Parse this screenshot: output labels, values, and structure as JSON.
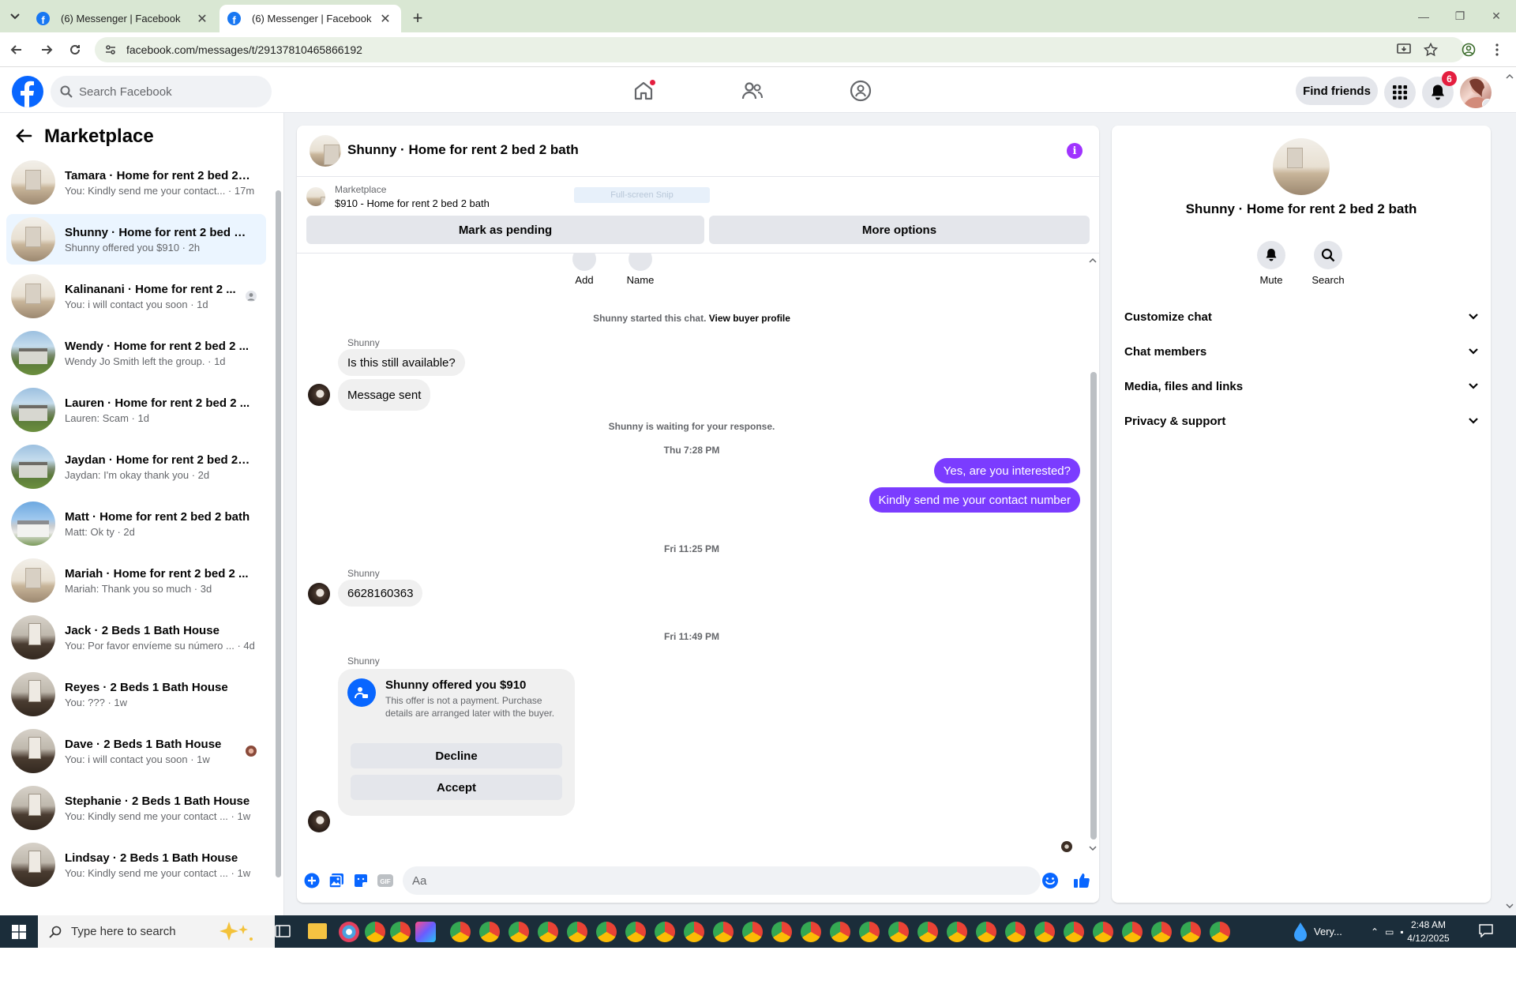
{
  "browser": {
    "tabs": [
      {
        "title": "(6) Messenger | Facebook",
        "active": false
      },
      {
        "title": "(6) Messenger | Facebook",
        "active": true
      }
    ],
    "url": "facebook.com/messages/t/29137810465866192"
  },
  "fb_header": {
    "search_placeholder": "Search Facebook",
    "find_friends": "Find friends",
    "notification_count": "6",
    "brand_color": "#0866ff"
  },
  "sidebar": {
    "title": "Marketplace",
    "conversations": [
      {
        "name": "Tamara · Home for rent 2 bed 2 ...",
        "preview": "You: Kindly send me your contact... · 17m",
        "thumb": "room",
        "selected": false
      },
      {
        "name": "Shunny · Home for rent 2 bed 2 ...",
        "preview": "Shunny offered you $910 · 2h",
        "thumb": "room",
        "selected": true
      },
      {
        "name": "Kalinanani · Home for rent 2 ...",
        "preview": "You: i will contact you soon · 1d",
        "thumb": "room",
        "selected": false
      },
      {
        "name": "Wendy · Home for rent 2 bed 2 ...",
        "preview": "Wendy Jo Smith left the group. · 1d",
        "thumb": "house",
        "selected": false
      },
      {
        "name": "Lauren · Home for rent 2 bed 2 ...",
        "preview": "Lauren: Scam · 1d",
        "thumb": "house",
        "selected": false
      },
      {
        "name": "Jaydan · Home for rent 2 bed 2 ...",
        "preview": "Jaydan: I'm okay thank you · 2d",
        "thumb": "house",
        "selected": false
      },
      {
        "name": "Matt · Home for rent 2 bed 2 bath",
        "preview": "Matt: Ok ty · 2d",
        "thumb": "matt",
        "selected": false
      },
      {
        "name": "Mariah · Home for rent 2 bed 2 ...",
        "preview": "Mariah: Thank you so much · 3d",
        "thumb": "room",
        "selected": false
      },
      {
        "name": "Jack · 2 Beds 1 Bath House",
        "preview": "You: Por favor envíeme su número ... · 4d",
        "thumb": "dark",
        "selected": false
      },
      {
        "name": "Reyes · 2 Beds 1 Bath House",
        "preview": "You: ??? · 1w",
        "thumb": "dark",
        "selected": false
      },
      {
        "name": "Dave · 2 Beds 1 Bath House",
        "preview": "You: i will contact you soon · 1w",
        "thumb": "dark",
        "selected": false
      },
      {
        "name": "Stephanie · 2 Beds 1 Bath House",
        "preview": "You: Kindly send me your contact ... · 1w",
        "thumb": "dark",
        "selected": false
      },
      {
        "name": "Lindsay · 2 Beds 1 Bath House",
        "preview": "You: Kindly send me your contact ... · 1w",
        "thumb": "dark",
        "selected": false
      }
    ]
  },
  "chat": {
    "title": "Shunny · Home for rent 2 bed 2 bath",
    "marketplace_label": "Marketplace",
    "listing": "$910 - Home for rent 2 bed 2 bath",
    "snip_hint": "Full-screen Snip",
    "mark_pending": "Mark as pending",
    "more_options": "More options",
    "quick_actions": [
      "Add",
      "Name"
    ],
    "started_note": "Shunny started this chat.",
    "view_buyer": "View buyer profile",
    "sender": "Shunny",
    "msg1": "Is this still available?",
    "msg2": "Message sent",
    "waiting_note": "Shunny is waiting for your response.",
    "time1": "Thu 7:28 PM",
    "out1": "Yes, are you interested?",
    "out2": "Kindly send me your contact number",
    "time2": "Fri 11:25 PM",
    "msg3": "6628160363",
    "time3": "Fri 11:49 PM",
    "offer_title": "Shunny offered you $910",
    "offer_desc": "This offer is not a payment. Purchase details are arranged later with the buyer.",
    "decline": "Decline",
    "accept": "Accept",
    "composer_placeholder": "Aa",
    "accent_color": "#7b3cff"
  },
  "info_panel": {
    "name": "Shunny · Home for rent 2 bed 2 bath",
    "mute": "Mute",
    "search": "Search",
    "sections": [
      "Customize chat",
      "Chat members",
      "Media, files and links",
      "Privacy & support"
    ]
  },
  "taskbar": {
    "search_placeholder": "Type here to search",
    "weather": "Very...",
    "time": "2:48 AM",
    "date": "4/12/2025"
  }
}
